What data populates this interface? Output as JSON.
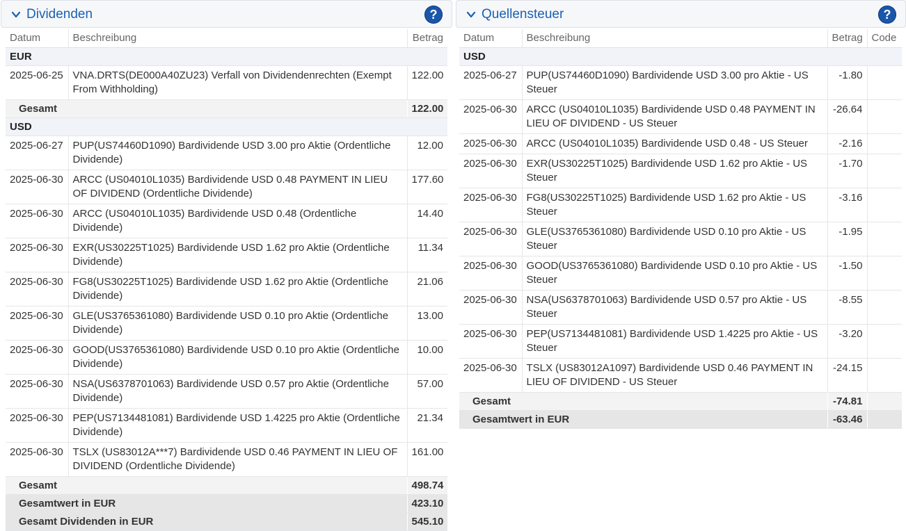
{
  "left": {
    "title": "Dividenden",
    "help": "?",
    "columns": [
      "Datum",
      "Beschreibung",
      "Betrag"
    ],
    "eur_label": "EUR",
    "eur_rows": [
      {
        "date": "2025-06-25",
        "desc": "VNA.DRTS(DE000A40ZU23) Verfall von Dividendenrechten (Exempt From Withholding)",
        "amount": "122.00"
      }
    ],
    "eur_total_label": "Gesamt",
    "eur_total": "122.00",
    "usd_label": "USD",
    "usd_rows": [
      {
        "date": "2025-06-27",
        "desc": "PUP(US74460D1090) Bardividende USD 3.00 pro Aktie (Ordentliche Dividende)",
        "amount": "12.00"
      },
      {
        "date": "2025-06-30",
        "desc": "ARCC (US04010L1035) Bardividende USD 0.48 PAYMENT IN LIEU OF DIVIDEND (Ordentliche Dividende)",
        "amount": "177.60"
      },
      {
        "date": "2025-06-30",
        "desc": "ARCC (US04010L1035) Bardividende USD 0.48 (Ordentliche Dividende)",
        "amount": "14.40"
      },
      {
        "date": "2025-06-30",
        "desc": "EXR(US30225T1025) Bardividende USD 1.62 pro Aktie (Ordentliche Dividende)",
        "amount": "11.34"
      },
      {
        "date": "2025-06-30",
        "desc": "FG8(US30225T1025) Bardividende USD 1.62 pro Aktie (Ordentliche Dividende)",
        "amount": "21.06"
      },
      {
        "date": "2025-06-30",
        "desc": "GLE(US3765361080) Bardividende USD 0.10 pro Aktie (Ordentliche Dividende)",
        "amount": "13.00"
      },
      {
        "date": "2025-06-30",
        "desc": "GOOD(US3765361080) Bardividende USD 0.10 pro Aktie (Ordentliche Dividende)",
        "amount": "10.00"
      },
      {
        "date": "2025-06-30",
        "desc": "NSA(US6378701063) Bardividende USD 0.57 pro Aktie (Ordentliche Dividende)",
        "amount": "57.00"
      },
      {
        "date": "2025-06-30",
        "desc": "PEP(US7134481081) Bardividende USD 1.4225 pro Aktie (Ordentliche Dividende)",
        "amount": "21.34"
      },
      {
        "date": "2025-06-30",
        "desc": "TSLX (US83012A***7) Bardividende USD 0.46 PAYMENT IN LIEU OF DIVIDEND (Ordentliche Dividende)",
        "amount": "161.00"
      }
    ],
    "usd_total_label": "Gesamt",
    "usd_total": "498.74",
    "eur_value_label": "Gesamtwert in EUR",
    "eur_value": "423.10",
    "grand_total_label": "Gesamt Dividenden in EUR",
    "grand_total": "545.10"
  },
  "right": {
    "title": "Quellensteuer",
    "help": "?",
    "columns": [
      "Datum",
      "Beschreibung",
      "Betrag",
      "Code"
    ],
    "usd_label": "USD",
    "usd_rows": [
      {
        "date": "2025-06-27",
        "desc": "PUP(US74460D1090) Bardividende USD 3.00 pro Aktie - US Steuer",
        "amount": "-1.80",
        "code": ""
      },
      {
        "date": "2025-06-30",
        "desc": "ARCC (US04010L1035) Bardividende USD 0.48 PAYMENT IN LIEU OF DIVIDEND - US Steuer",
        "amount": "-26.64",
        "code": ""
      },
      {
        "date": "2025-06-30",
        "desc": "ARCC (US04010L1035) Bardividende USD 0.48 - US Steuer",
        "amount": "-2.16",
        "code": ""
      },
      {
        "date": "2025-06-30",
        "desc": "EXR(US30225T1025) Bardividende USD 1.62 pro Aktie - US Steuer",
        "amount": "-1.70",
        "code": ""
      },
      {
        "date": "2025-06-30",
        "desc": "FG8(US30225T1025) Bardividende USD 1.62 pro Aktie - US Steuer",
        "amount": "-3.16",
        "code": ""
      },
      {
        "date": "2025-06-30",
        "desc": "GLE(US3765361080) Bardividende USD 0.10 pro Aktie - US Steuer",
        "amount": "-1.95",
        "code": ""
      },
      {
        "date": "2025-06-30",
        "desc": "GOOD(US3765361080) Bardividende USD 0.10 pro Aktie - US Steuer",
        "amount": "-1.50",
        "code": ""
      },
      {
        "date": "2025-06-30",
        "desc": "NSA(US6378701063) Bardividende USD 0.57 pro Aktie - US Steuer",
        "amount": "-8.55",
        "code": ""
      },
      {
        "date": "2025-06-30",
        "desc": "PEP(US7134481081) Bardividende USD 1.4225 pro Aktie - US Steuer",
        "amount": "-3.20",
        "code": ""
      },
      {
        "date": "2025-06-30",
        "desc": "TSLX (US83012A1097) Bardividende USD 0.46 PAYMENT IN LIEU OF DIVIDEND - US Steuer",
        "amount": "-24.15",
        "code": ""
      }
    ],
    "usd_total_label": "Gesamt",
    "usd_total": "-74.81",
    "eur_value_label": "Gesamtwert in EUR",
    "eur_value": "-63.46"
  },
  "colors": {
    "title": "#1a61b4",
    "help_bg": "#1a56a9",
    "currency_row_bg": "#f1f3f8",
    "total_bg": "#f3f3f3",
    "total2_bg": "#e6e6e6"
  },
  "icons": {
    "collapse": "chevron-down-icon",
    "help": "help-icon"
  }
}
